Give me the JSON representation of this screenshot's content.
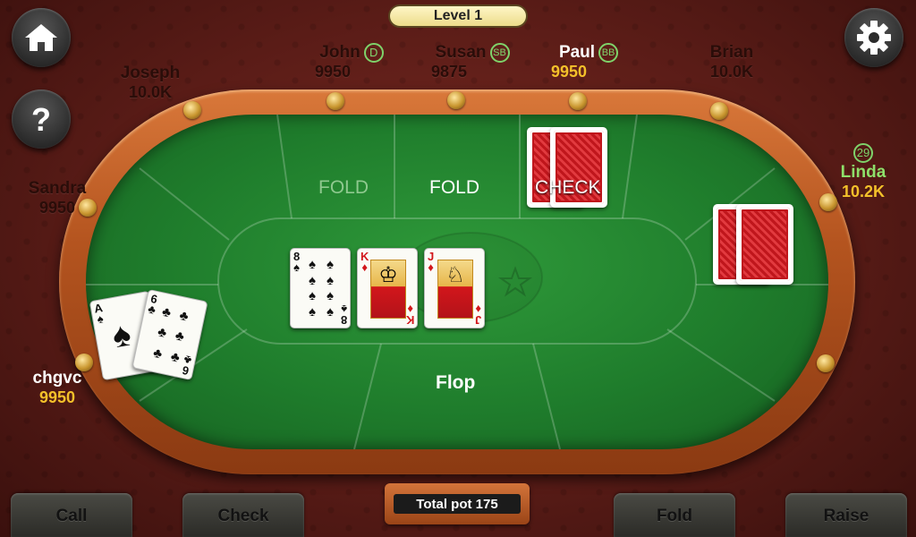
{
  "level": "Level 1",
  "players": {
    "john": {
      "name": "John",
      "chips": "9950",
      "badge": "D"
    },
    "susan": {
      "name": "Susan",
      "chips": "9875",
      "badge": "SB"
    },
    "paul": {
      "name": "Paul",
      "chips": "9950",
      "badge": "BB"
    },
    "brian": {
      "name": "Brian",
      "chips": "10.0K"
    },
    "joseph": {
      "name": "Joseph",
      "chips": "10.0K"
    },
    "sandra": {
      "name": "Sandra",
      "chips": "9950"
    },
    "linda": {
      "name": "Linda",
      "chips": "10.2K",
      "timer": "29"
    },
    "me": {
      "name": "chgvc",
      "chips": "9950"
    }
  },
  "table": {
    "actions": {
      "sandra_fold": "FOLD",
      "susan_fold": "FOLD",
      "paul_check": "CHECK"
    },
    "stage": "Flop"
  },
  "community_cards": [
    {
      "rank": "8",
      "suit": "♠",
      "color": "black"
    },
    {
      "rank": "K",
      "suit": "♦",
      "color": "red"
    },
    {
      "rank": "J",
      "suit": "♦",
      "color": "red"
    }
  ],
  "hole_cards": [
    {
      "rank": "A",
      "suit": "♠",
      "color": "black"
    },
    {
      "rank": "6",
      "suit": "♣",
      "color": "black"
    }
  ],
  "pot": "Total pot 175",
  "buttons": {
    "call": "Call",
    "check": "Check",
    "fold": "Fold",
    "raise": "Raise"
  },
  "icons": {
    "home": "home-icon",
    "help": "help-icon",
    "settings": "gear-icon"
  },
  "colors": {
    "felt": "#1f7d2c",
    "gold": "#f3c02a",
    "active_green": "#8ee06a"
  }
}
